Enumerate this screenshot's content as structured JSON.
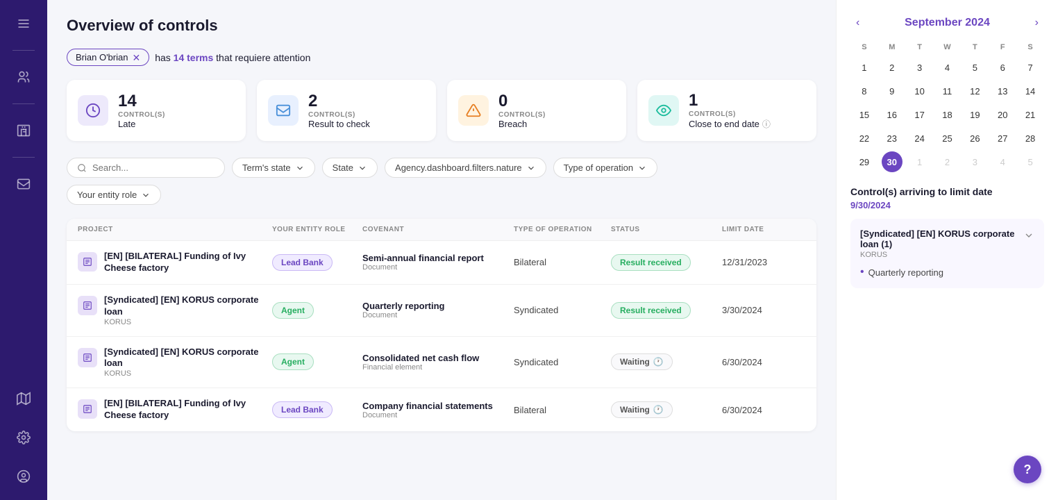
{
  "page": {
    "title": "Overview of controls"
  },
  "sidebar": {
    "icons": [
      {
        "name": "menu-icon",
        "symbol": "☰"
      },
      {
        "name": "users-icon",
        "symbol": "👥"
      },
      {
        "name": "building-icon",
        "symbol": "🏢"
      },
      {
        "name": "mail-icon",
        "symbol": "✉"
      },
      {
        "name": "map-icon",
        "symbol": "🗺"
      },
      {
        "name": "settings-icon",
        "symbol": "⚙"
      },
      {
        "name": "user-circle-icon",
        "symbol": "👤"
      }
    ]
  },
  "alert": {
    "user": "Brian O'brian",
    "count": "14",
    "message": " has ",
    "terms": "14 terms",
    "suffix": " that requiere attention"
  },
  "stats": [
    {
      "number": "14",
      "label": "CONTROL(S)",
      "sublabel": "Late",
      "icon": "clock",
      "color": "purple"
    },
    {
      "number": "2",
      "label": "CONTROL(S)",
      "sublabel": "Result to check",
      "icon": "envelope",
      "color": "blue"
    },
    {
      "number": "0",
      "label": "CONTROL(S)",
      "sublabel": "Breach",
      "icon": "warning",
      "color": "orange"
    },
    {
      "number": "1",
      "label": "CONTROL(S)",
      "sublabel": "Close to end date",
      "icon": "eye",
      "color": "teal"
    }
  ],
  "filters": {
    "search_placeholder": "Search...",
    "terms_state": "Term's state",
    "state": "State",
    "agency": "Agency.dashboard.filters.nature",
    "operation": "Type of operation",
    "entity_role": "Your entity role"
  },
  "table": {
    "headers": [
      "PROJECT",
      "YOUR ENTITY ROLE",
      "COVENANT",
      "TYPE OF OPERATION",
      "STATUS",
      "LIMIT DATE"
    ],
    "rows": [
      {
        "project": "[EN] [BILATERAL] Funding of Ivy Cheese factory",
        "sub": "",
        "role": "Lead Bank",
        "roleType": "lead",
        "covenant": "Semi-annual financial report",
        "covenantType": "Document",
        "operation": "Bilateral",
        "status": "Result received",
        "statusType": "result",
        "hasClock": false,
        "limitDate": "12/31/2023"
      },
      {
        "project": "[Syndicated] [EN] KORUS corporate loan",
        "sub": "KORUS",
        "role": "Agent",
        "roleType": "agent",
        "covenant": "Quarterly reporting",
        "covenantType": "Document",
        "operation": "Syndicated",
        "status": "Result received",
        "statusType": "result",
        "hasClock": false,
        "limitDate": "3/30/2024"
      },
      {
        "project": "[Syndicated] [EN] KORUS corporate loan",
        "sub": "KORUS",
        "role": "Agent",
        "roleType": "agent",
        "covenant": "Consolidated net cash flow",
        "covenantType": "Financial element",
        "operation": "Syndicated",
        "status": "Waiting",
        "statusType": "waiting",
        "hasClock": true,
        "limitDate": "6/30/2024"
      },
      {
        "project": "[EN] [BILATERAL] Funding of Ivy Cheese factory",
        "sub": "",
        "role": "Lead Bank",
        "roleType": "lead",
        "covenant": "Company financial statements",
        "covenantType": "Document",
        "operation": "Bilateral",
        "status": "Waiting",
        "statusType": "waiting",
        "hasClock": true,
        "limitDate": "6/30/2024"
      }
    ]
  },
  "calendar": {
    "month": "September 2024",
    "days": [
      "S",
      "M",
      "T",
      "W",
      "T",
      "F",
      "S"
    ],
    "weeks": [
      [
        {
          "day": "1",
          "month": "current"
        },
        {
          "day": "2",
          "month": "current"
        },
        {
          "day": "3",
          "month": "current"
        },
        {
          "day": "4",
          "month": "current"
        },
        {
          "day": "5",
          "month": "current"
        },
        {
          "day": "6",
          "month": "current"
        },
        {
          "day": "7",
          "month": "current"
        }
      ],
      [
        {
          "day": "8",
          "month": "current"
        },
        {
          "day": "9",
          "month": "current"
        },
        {
          "day": "10",
          "month": "current"
        },
        {
          "day": "11",
          "month": "current"
        },
        {
          "day": "12",
          "month": "current"
        },
        {
          "day": "13",
          "month": "current"
        },
        {
          "day": "14",
          "month": "current"
        }
      ],
      [
        {
          "day": "15",
          "month": "current"
        },
        {
          "day": "16",
          "month": "current"
        },
        {
          "day": "17",
          "month": "current"
        },
        {
          "day": "18",
          "month": "current"
        },
        {
          "day": "19",
          "month": "current"
        },
        {
          "day": "20",
          "month": "current"
        },
        {
          "day": "21",
          "month": "current"
        }
      ],
      [
        {
          "day": "22",
          "month": "current"
        },
        {
          "day": "23",
          "month": "current"
        },
        {
          "day": "24",
          "month": "current"
        },
        {
          "day": "25",
          "month": "current"
        },
        {
          "day": "26",
          "month": "current"
        },
        {
          "day": "27",
          "month": "current"
        },
        {
          "day": "28",
          "month": "current"
        }
      ],
      [
        {
          "day": "29",
          "month": "current"
        },
        {
          "day": "30",
          "month": "current",
          "today": true,
          "dot": true
        },
        {
          "day": "1",
          "month": "next"
        },
        {
          "day": "2",
          "month": "next"
        },
        {
          "day": "3",
          "month": "next"
        },
        {
          "day": "4",
          "month": "next"
        },
        {
          "day": "5",
          "month": "next"
        }
      ]
    ]
  },
  "arriving": {
    "title": "Control(s) arriving to limit date",
    "date": "9/30/2024",
    "loan": "[Syndicated] [EN] KORUS corporate loan (1)",
    "loanSub": "KORUS",
    "item": "Quarterly reporting"
  },
  "help": {
    "label": "?"
  }
}
